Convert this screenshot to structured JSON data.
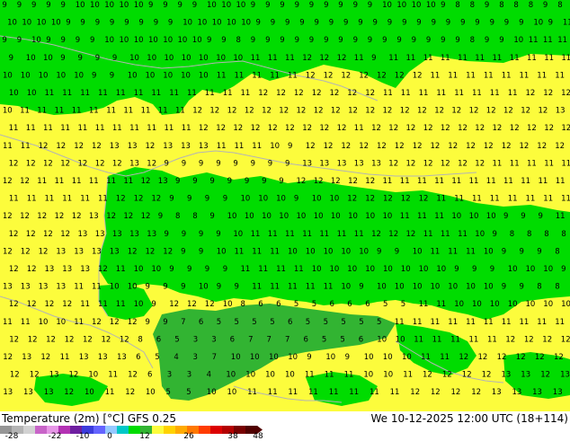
{
  "map": {
    "title": "Temperature (2m) [°C] GFS 0.25",
    "valid": "We 10-12-2025 12:00 UTC (18+114)",
    "legend": {
      "ticks": [
        "-28",
        "-22",
        "-10",
        "0",
        "12",
        "26",
        "38",
        "48"
      ],
      "colors": [
        "#969696",
        "#b4b4b4",
        "#d2d2d2",
        "#c864c8",
        "#e696e6",
        "#b432b4",
        "#6e1ea0",
        "#3c3cdc",
        "#6464ff",
        "#96c8ff",
        "#00c8c8",
        "#00dc00",
        "#32b432",
        "#fcfc3c",
        "#ffd200",
        "#ffaa00",
        "#ff7800",
        "#ff3c00",
        "#dc0000",
        "#b40000",
        "#780000",
        "#500000"
      ]
    },
    "zone_colors": {
      "warm": "#fcfc3c",
      "mild": "#00dc00",
      "cool": "#32b432",
      "coast_line": "#b4b4b4"
    },
    "rows": [
      "9 9 9 9 9 10 10 10 10 10 9 9 9 9 10 10 10 9 9 9 9 9 9 9 9 9 10 10 10 10 9 8 8 9 8 8 8 9 8",
      "10 10 10 10 9 9 9 9 9 9 9 9 10 10 10 10 10 9 9 9 9 9 9 9 9 9 9 9 9 9 9 9 9 9 9 9 10 9 11",
      "9 9 10 9 9 9 9 10 10 10 10 10 10 10 9 9 8 9 9 9 9 9 9 9 9 9 9 9 9 9 9 9 8 9 9 10 11 11 11",
      "9 10 10 9 9 9 9 10 10 10 10 10 10 10 11 11 11 12 12 12 11 9 11 11 11 11 11 11 11 11 11 11 11",
      "10 10 10 10 10 9 9 10 10 10 10 10 11 11 11 11 11 12 12 12 12 12 12 12 11 11 11 11 11 11 11 11",
      "10 10 11 11 11 11 11 11 11 11 11 11 11 11 12 12 12 12 12 12 12 11 11 11 11 11 11 11 11 12 12 12",
      "10 11 11 11 11 11 11 11 11 11 11 12 12 12 12 12 12 12 12 12 12 12 12 12 12 12 12 12 12 12 12 12 13",
      "11 11 11 11 11 11 11 11 11 11 11 12 12 12 12 12 12 12 12 12 11 12 12 12 12 12 12 12 12 12 12 12 12",
      "11 11 12 12 12 12 13 13 12 13 13 13 11 11 11 10 9 12 12 12 12 12 12 12 12 12 12 12 12 12 12 12",
      "12 12 12 12 12 12 12 13 12 9 9 9 9 9 9 9 9 13 13 13 13 13 12 12 12 12 12 12 11 11 11 11 11",
      "12 12 11 11 11 11 11 11 12 13 9 9 9 9 9 9 9 12 12 12 12 12 11 11 11 11 11 11 11 11 11 11 11",
      "11 11 11 11 11 11 12 12 12 9 9 9 9 10 10 10 9 10 10 12 12 12 12 12 11 11 11 11 11 11 11 11",
      "12 12 12 12 12 13 12 12 12 9 8 8 9 10 10 10 10 10 10 10 10 10 10 11 11 11 10 10 10 9 9 9 11",
      "12 12 12 12 13 13 13 13 13 9 9 9 9 10 11 11 11 11 11 11 11 12 12 12 11 11 11 10 9 8 8 8 8",
      "12 12 12 13 13 13 13 12 12 12 9 9 10 11 11 11 10 10 10 10 10 9 9 10 11 11 11 10 9 9 9 8",
      "12 12 13 13 13 12 11 10 10 9 9 9 9 11 11 11 11 10 10 10 10 10 10 10 10 9 9 9 10 10 10 9",
      "13 13 13 13 11 11 10 10 9 9 9 10 9 9 11 11 11 11 11 10 9 10 10 10 10 10 10 10 9 9 8 8",
      "12 12 12 12 11 11 11 10 9 12 12 12 10 8 6 6 5 5 6 6 6 5 5 11 11 10 10 10 10 10 10 10",
      "11 11 10 10 11 12 12 12 9 9 7 6 5 5 5 5 6 5 5 5 5 5 11 11 11 11 11 11 11 11 11 11",
      "12 12 12 12 12 12 12 8 6 5 3 3 6 7 7 7 6 5 5 6 10 10 11 11 11 11 11 12 12 12 12",
      "12 13 12 11 13 13 13 6 5 4 3 7 10 10 10 10 9 10 9 10 10 10 11 11 12 12 12 12 12 12",
      "12 12 13 12 10 11 12 6 3 3 4 10 10 10 10 11 11 11 10 10 11 12 12 12 12 13 13 12 13",
      "13 13 13 12 10 11 12 10 5 5 10 10 11 11 11 11 11 11 11 11 12 12 12 12 13 13 13 13"
    ]
  }
}
